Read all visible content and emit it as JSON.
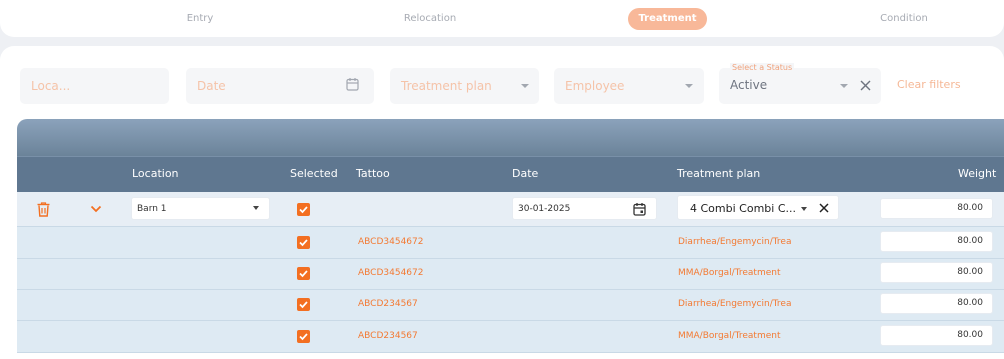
{
  "tabs": [
    {
      "label": "Entry",
      "active": false
    },
    {
      "label": "Relocation",
      "active": false
    },
    {
      "label": "Treatment",
      "active": true
    },
    {
      "label": "Condition",
      "active": false
    }
  ],
  "filters": {
    "location_placeholder": "Loca...",
    "date_placeholder": "Date",
    "treatment_plan_placeholder": "Treatment plan",
    "employee_placeholder": "Employee",
    "status_label": "Select a Status",
    "status_value": "Active",
    "clear_label": "Clear filters"
  },
  "columns": {
    "location": "Location",
    "selected": "Selected",
    "tattoo": "Tattoo",
    "date": "Date",
    "treatment_plan": "Treatment plan",
    "weight": "Weight"
  },
  "edit_row": {
    "location": "Barn 1",
    "date": "30-01-2025",
    "treatment_plan": "4 Combi Combi C...",
    "weight": "80.00",
    "selected": true
  },
  "rows": [
    {
      "tattoo": "ABCD3454672",
      "treatment_plan": "Diarrhea/Engemycin/Treatment",
      "weight": "80.00",
      "selected": true
    },
    {
      "tattoo": "ABCD3454672",
      "treatment_plan": "MMA/Borgal/Treatment",
      "weight": "80.00",
      "selected": true
    },
    {
      "tattoo": "ABCD234567",
      "treatment_plan": "Diarrhea/Engemycin/Treatment",
      "weight": "80.00",
      "selected": true
    },
    {
      "tattoo": "ABCD234567",
      "treatment_plan": "MMA/Borgal/Treatment",
      "weight": "80.00",
      "selected": true
    }
  ],
  "colors": {
    "accent": "#f36f21",
    "header": "#5f7790",
    "row": "#deeaf3"
  }
}
